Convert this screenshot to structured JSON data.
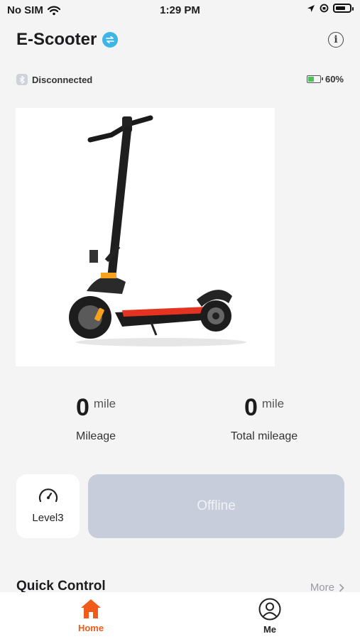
{
  "status_bar": {
    "carrier": "No SIM",
    "time": "1:29 PM",
    "battery_level": 0.7
  },
  "header": {
    "title": "E-Scooter"
  },
  "connection": {
    "status": "Disconnected",
    "battery_percent": "60%",
    "battery_fill": 0.6
  },
  "stats": {
    "mileage": {
      "value": "0",
      "unit": "mile",
      "label": "Mileage"
    },
    "total_mileage": {
      "value": "0",
      "unit": "mile",
      "label": "Total mileage"
    }
  },
  "controls": {
    "level_label": "Level3",
    "offline_label": "Offline"
  },
  "quick_control": {
    "title": "Quick Control",
    "more_label": "More"
  },
  "tab_bar": {
    "home": {
      "label": "Home",
      "color": "#f05a1a"
    },
    "me": {
      "label": "Me",
      "color": "#222222"
    }
  },
  "colors": {
    "accent": "#3db5e6",
    "battery_green": "#4cc25a",
    "offline_bg": "#c8cddb"
  }
}
